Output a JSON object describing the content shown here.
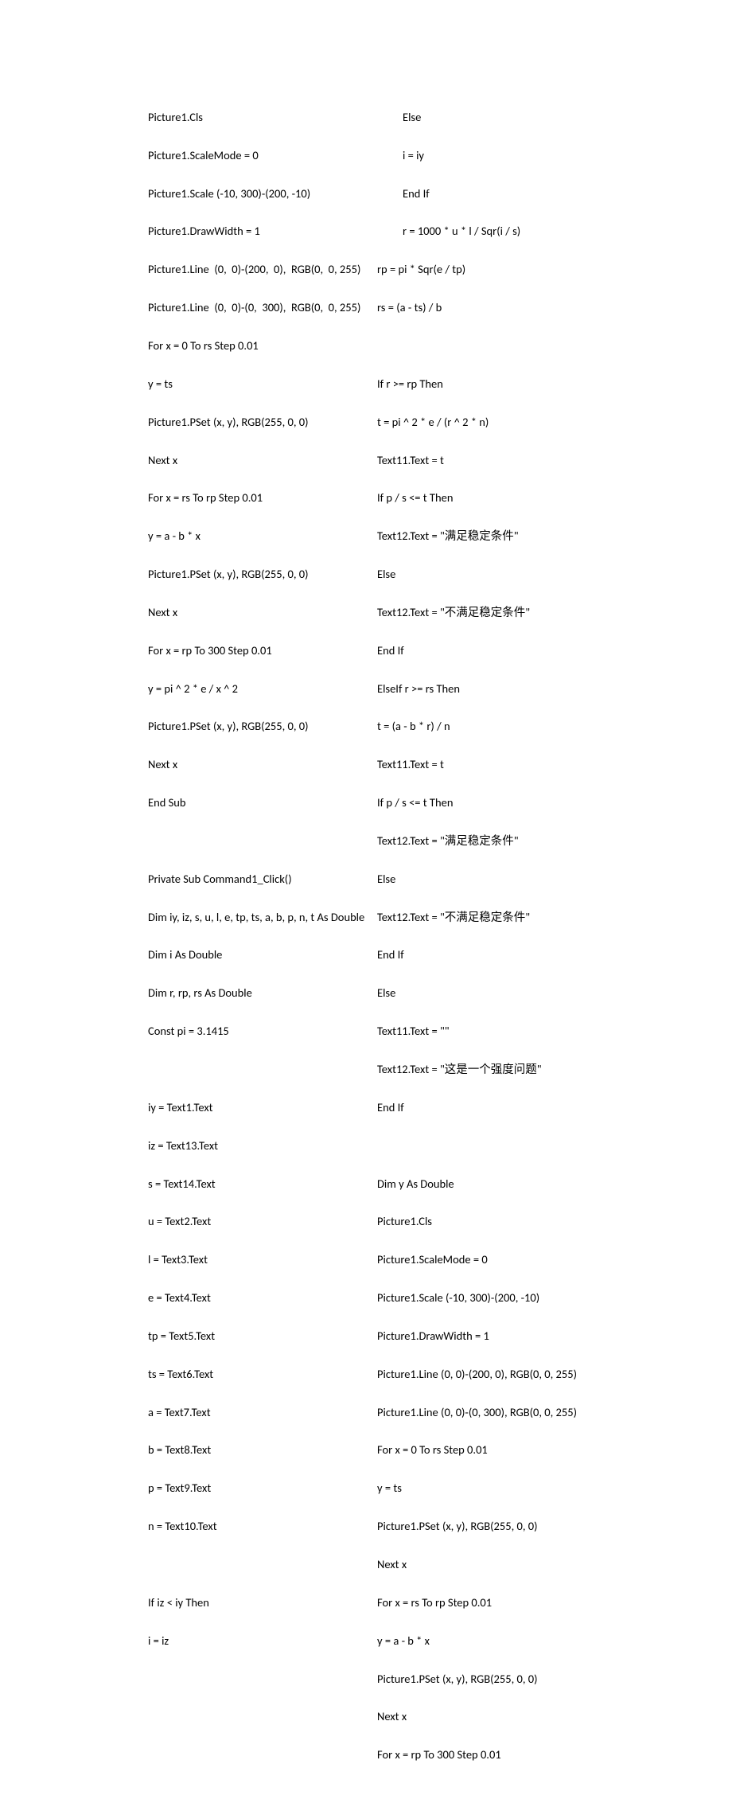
{
  "left": {
    "l1": "Picture1.Cls",
    "l2": "Picture1.ScaleMode = 0",
    "l3": "Picture1.Scale (-10, 300)-(200, -10)",
    "l4": "Picture1.DrawWidth = 1",
    "l5": "Picture1.Line  (0,  0)-(200,  0),  RGB(0,  0, 255)",
    "l6": "Picture1.Line  (0,  0)-(0,  300),  RGB(0,  0, 255)",
    "l7": "For x = 0 To rs Step 0.01",
    "l8": "y = ts",
    "l9": "Picture1.PSet (x, y), RGB(255, 0, 0)",
    "l10": "Next x",
    "l11": "For x = rs To rp Step 0.01",
    "l12": "y = a - b * x",
    "l13": "Picture1.PSet (x, y), RGB(255, 0, 0)",
    "l14": "Next x",
    "l15": "For x = rp To 300 Step 0.01",
    "l16": "y = pi ^ 2 * e / x ^ 2",
    "l17": "Picture1.PSet (x, y), RGB(255, 0, 0)",
    "l18": "Next x",
    "l19": "End Sub",
    "l20": "",
    "l21": "Private Sub Command1_Click()",
    "l22": "Dim iy, iz, s, u, l, e, tp, ts, a, b, p, n, t As Double",
    "l23": "Dim i As Double",
    "l24": "Dim r, rp, rs As Double",
    "l25": "Const pi = 3.1415",
    "l26": "",
    "l27": "iy = Text1.Text",
    "l28": "iz = Text13.Text",
    "l29": "s = Text14.Text",
    "l30": "u = Text2.Text",
    "l31": "l = Text3.Text",
    "l32": "e = Text4.Text",
    "l33": "tp = Text5.Text",
    "l34": "ts = Text6.Text",
    "l35": "a = Text7.Text",
    "l36": "b = Text8.Text",
    "l37": "p = Text9.Text",
    "l38": "n = Text10.Text",
    "l39": "",
    "l40": "If iz < iy Then",
    "l41": "i = iz"
  },
  "right": {
    "r1": "Else",
    "r2": "i = iy",
    "r3": "End If",
    "r4": "r = 1000 * u * l / Sqr(i / s)",
    "r5": "rp = pi * Sqr(e / tp)",
    "r6": "rs = (a - ts) / b",
    "r7": "",
    "r8": "If r >= rp Then",
    "r9": "t = pi ^ 2 * e / (r ^ 2 * n)",
    "r10": "Text11.Text = t",
    "r11": "If p / s <= t Then",
    "r12": "Text12.Text = \"满足稳定条件\"",
    "r13": "Else",
    "r14": "Text12.Text = \"不满足稳定条件\"",
    "r15": "End If",
    "r16": "ElseIf r >= rs Then",
    "r17": "t = (a - b * r) / n",
    "r18": "Text11.Text = t",
    "r19": "If p / s <= t Then",
    "r20": "Text12.Text = \"满足稳定条件\"",
    "r21": "Else",
    "r22": "Text12.Text = \"不满足稳定条件\"",
    "r23": "End If",
    "r24": "Else",
    "r25": "Text11.Text = \"\"",
    "r26": "Text12.Text = \"这是一个强度问题\"",
    "r27": "End If",
    "r28": "",
    "r29": "Dim y As Double",
    "r30": "Picture1.Cls",
    "r31": "Picture1.ScaleMode = 0",
    "r32": "Picture1.Scale (-10, 300)-(200, -10)",
    "r33": "Picture1.DrawWidth = 1",
    "r34": "Picture1.Line (0, 0)-(200, 0), RGB(0, 0, 255)",
    "r35": "Picture1.Line (0, 0)-(0, 300), RGB(0, 0, 255)",
    "r36": "For x = 0 To rs Step 0.01",
    "r37": "y = ts",
    "r38": "Picture1.PSet (x, y), RGB(255, 0, 0)",
    "r39": "Next x",
    "r40": "For x = rs To rp Step 0.01",
    "r41": "y = a - b * x",
    "r42": "Picture1.PSet (x, y), RGB(255, 0, 0)",
    "r43": "Next x",
    "r44": "For x = rp To 300 Step 0.01"
  }
}
